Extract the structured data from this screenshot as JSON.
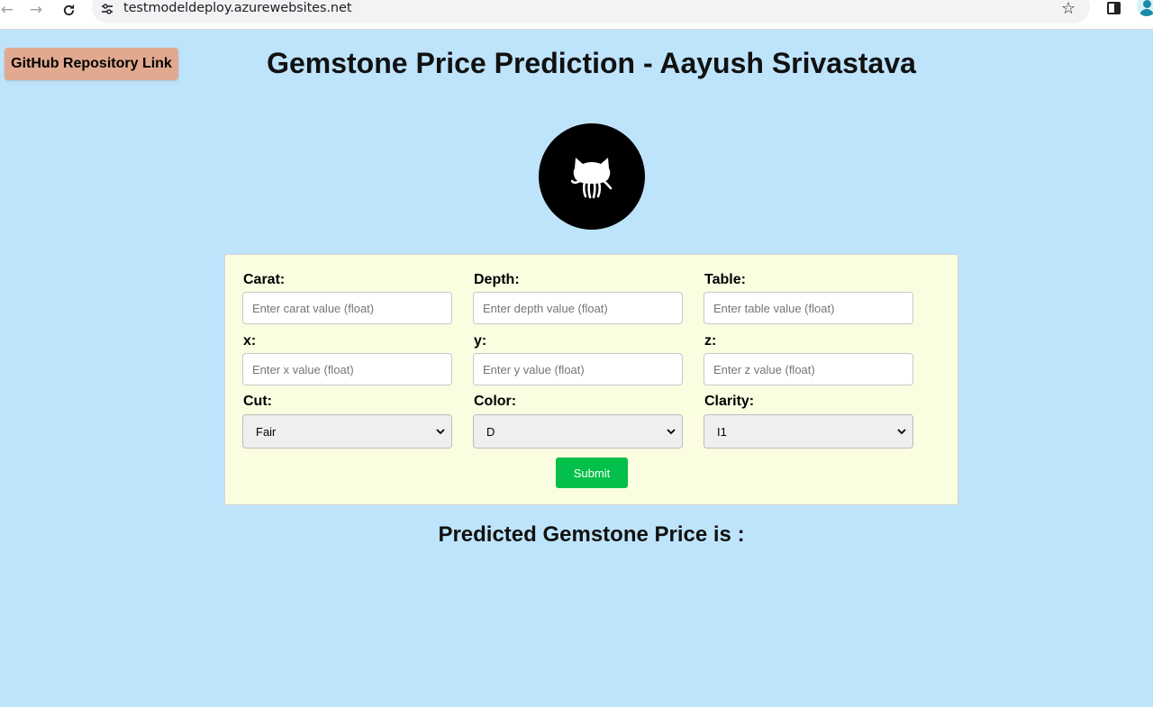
{
  "browser": {
    "url": "testmodeldeploy.azurewebsites.net"
  },
  "header": {
    "repo_link_label": "GitHub Repository Link",
    "title": "Gemstone Price Prediction - Aayush Srivastava"
  },
  "form": {
    "fields": [
      {
        "label": "Carat:",
        "placeholder": "Enter carat value (float)"
      },
      {
        "label": "Depth:",
        "placeholder": "Enter depth value (float)"
      },
      {
        "label": "Table:",
        "placeholder": "Enter table value (float)"
      },
      {
        "label": "x:",
        "placeholder": "Enter x value (float)"
      },
      {
        "label": "y:",
        "placeholder": "Enter y value (float)"
      },
      {
        "label": "z:",
        "placeholder": "Enter z value (float)"
      }
    ],
    "selects": [
      {
        "label": "Cut:",
        "value": "Fair"
      },
      {
        "label": "Color:",
        "value": "D"
      },
      {
        "label": "Clarity:",
        "value": "I1"
      }
    ],
    "submit_label": "Submit"
  },
  "result": {
    "text": "Predicted Gemstone Price is :"
  },
  "colors": {
    "page_bg": "#bee4fb",
    "card_bg": "#fafde0",
    "submit_bg": "#04c04a",
    "repo_button_bg": "#e1a98f"
  }
}
